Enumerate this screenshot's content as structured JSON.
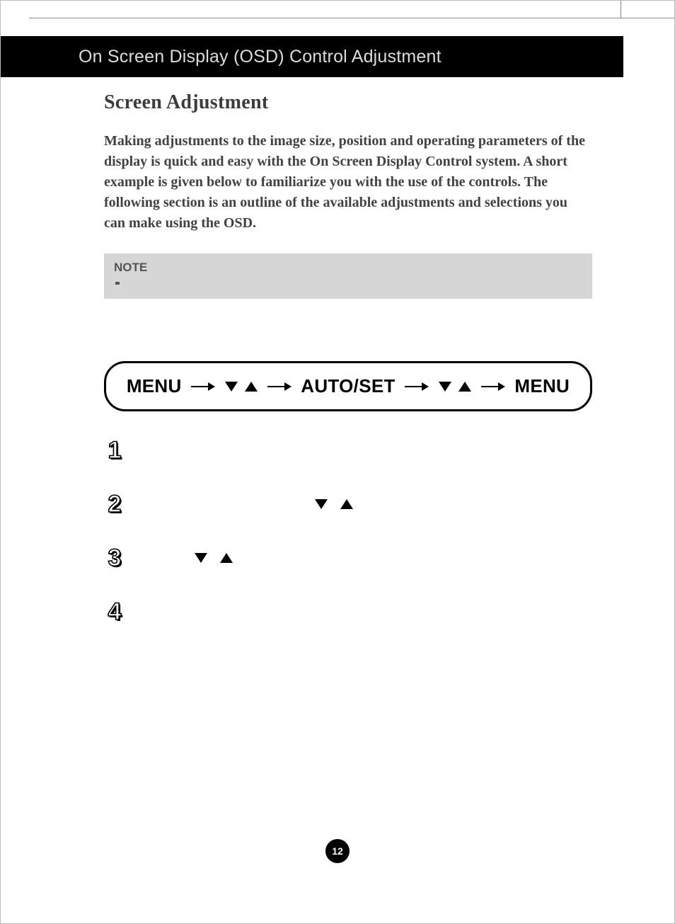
{
  "header": {
    "title": "On Screen Display (OSD) Control Adjustment"
  },
  "section": {
    "title": "Screen Adjustment"
  },
  "intro": {
    "text": "Making adjustments to the image size, position and operating parameters of the display is quick and easy with the On Screen Display Control system. A short example is given below to familiarize you with the use of the controls. The following section is an outline of the available adjustments and selections you can make using the OSD."
  },
  "note": {
    "label": "NOTE"
  },
  "flow": {
    "items": [
      {
        "type": "label",
        "text": "MENU"
      },
      {
        "type": "arrow"
      },
      {
        "type": "tri-pair"
      },
      {
        "type": "arrow"
      },
      {
        "type": "label",
        "text": "AUTO/SET"
      },
      {
        "type": "arrow"
      },
      {
        "type": "tri-pair"
      },
      {
        "type": "arrow"
      },
      {
        "type": "label",
        "text": "MENU"
      }
    ],
    "menu1": "MENU",
    "autoset": "AUTO/SET",
    "menu2": "MENU"
  },
  "steps": [
    {
      "num": "1",
      "tris": false
    },
    {
      "num": "2",
      "tris": true,
      "offset": "step2-offset"
    },
    {
      "num": "3",
      "tris": true,
      "offset": "step3-offset"
    },
    {
      "num": "4",
      "tris": false
    }
  ],
  "page_number": "12"
}
